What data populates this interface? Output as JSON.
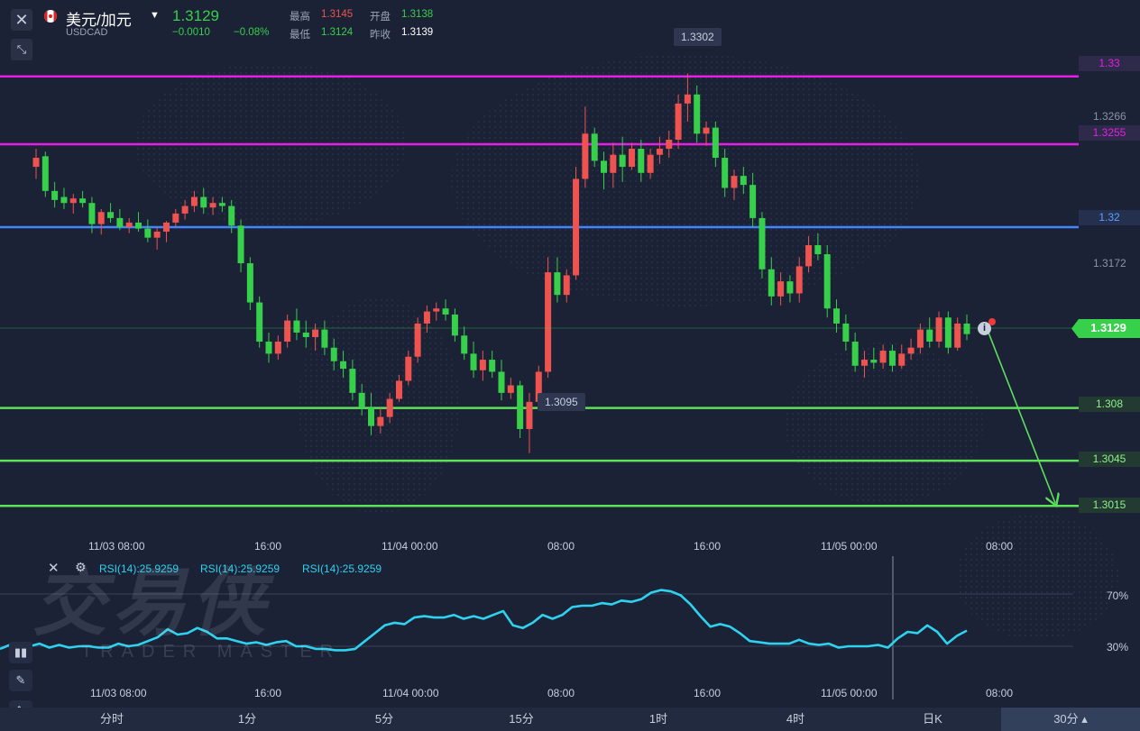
{
  "header": {
    "pair": "美元/加元",
    "symbol": "USDCAD",
    "last_price": "1.3129",
    "change": "−0.0010",
    "change_pct": "−0.08%",
    "high_label": "最高",
    "high": "1.3145",
    "open_label": "开盘",
    "open": "1.3138",
    "low_label": "最低",
    "low": "1.3124",
    "prev_close_label": "昨收",
    "prev_close": "1.3139",
    "up_color": "#37d04a",
    "down_color": "#ef5350"
  },
  "price_axis": {
    "labels": [
      "1.3266",
      "1.3172"
    ],
    "current_price_tag": "1.3129"
  },
  "levels": [
    {
      "label": "1.33",
      "color": "#e61ee6"
    },
    {
      "label": "1.3255",
      "color": "#e61ee6"
    },
    {
      "label": "1.32",
      "color": "#3f86ff"
    },
    {
      "label": "1.308",
      "color": "#5de05a"
    },
    {
      "label": "1.3045",
      "color": "#5de05a"
    },
    {
      "label": "1.3015",
      "color": "#5de05a"
    }
  ],
  "annotations": {
    "high_marker": "1.3302",
    "low_marker": "1.3095"
  },
  "time_axis_main": [
    "11/03 08:00",
    "16:00",
    "11/04 00:00",
    "08:00",
    "16:00",
    "11/05 00:00",
    "08:00"
  ],
  "time_axis_rsi": [
    "11/03 08:00",
    "16:00",
    "11/04 00:00",
    "08:00",
    "16:00",
    "11/05 00:00",
    "08:00"
  ],
  "rsi": {
    "legend": [
      "RSI(14):25.9259",
      "RSI(14):25.9259",
      "RSI(14):25.9259"
    ],
    "level_labels": [
      "70%",
      "30%"
    ],
    "line_color": "#2fd2ee"
  },
  "watermark": {
    "brand_cn": "交易侠",
    "brand_en": "TRADER MASTER"
  },
  "tabs": [
    "分时",
    "1分",
    "5分",
    "15分",
    "1时",
    "4时",
    "日K",
    "30分"
  ],
  "selected_tab": "30分",
  "icons": {
    "close": "close-icon",
    "resize": "resize-icon",
    "settings": "settings-icon",
    "indicator": "indicator-icon",
    "pen": "pen-icon",
    "rsi": "rsi-icon",
    "info": "info-icon"
  },
  "chart_data": {
    "type": "candlestick",
    "ohlc": [
      [
        1.324,
        1.3252,
        1.3232,
        1.3246
      ],
      [
        1.3247,
        1.325,
        1.322,
        1.3224
      ],
      [
        1.3224,
        1.323,
        1.3213,
        1.3218
      ],
      [
        1.322,
        1.3226,
        1.3212,
        1.3216
      ],
      [
        1.3216,
        1.3222,
        1.3209,
        1.3219
      ],
      [
        1.3219,
        1.3224,
        1.3213,
        1.3216
      ],
      [
        1.3216,
        1.322,
        1.3196,
        1.3202
      ],
      [
        1.3202,
        1.3212,
        1.3195,
        1.321
      ],
      [
        1.321,
        1.3216,
        1.3203,
        1.3206
      ],
      [
        1.3206,
        1.3212,
        1.3198,
        1.32
      ],
      [
        1.32,
        1.3206,
        1.3196,
        1.3203
      ],
      [
        1.3203,
        1.321,
        1.3197,
        1.3199
      ],
      [
        1.3199,
        1.3205,
        1.319,
        1.3193
      ],
      [
        1.3193,
        1.32,
        1.3185,
        1.3197
      ],
      [
        1.3197,
        1.3204,
        1.319,
        1.3203
      ],
      [
        1.3203,
        1.3212,
        1.32,
        1.3209
      ],
      [
        1.3209,
        1.3218,
        1.3205,
        1.3214
      ],
      [
        1.3214,
        1.3224,
        1.321,
        1.322
      ],
      [
        1.322,
        1.3226,
        1.3209,
        1.3213
      ],
      [
        1.3213,
        1.322,
        1.3208,
        1.3216
      ],
      [
        1.3216,
        1.322,
        1.321,
        1.3214
      ],
      [
        1.3214,
        1.3218,
        1.3196,
        1.3201
      ],
      [
        1.3201,
        1.3205,
        1.317,
        1.3176
      ],
      [
        1.3176,
        1.318,
        1.3145,
        1.315
      ],
      [
        1.315,
        1.3154,
        1.312,
        1.3124
      ],
      [
        1.3124,
        1.313,
        1.311,
        1.3116
      ],
      [
        1.3116,
        1.3128,
        1.3112,
        1.3124
      ],
      [
        1.3124,
        1.3142,
        1.312,
        1.3138
      ],
      [
        1.3138,
        1.3146,
        1.3125,
        1.313
      ],
      [
        1.313,
        1.3138,
        1.312,
        1.3127
      ],
      [
        1.3127,
        1.3136,
        1.3118,
        1.3132
      ],
      [
        1.3132,
        1.3138,
        1.3115,
        1.312
      ],
      [
        1.312,
        1.3126,
        1.3105,
        1.3111
      ],
      [
        1.3111,
        1.3118,
        1.31,
        1.3106
      ],
      [
        1.3106,
        1.3112,
        1.3085,
        1.309
      ],
      [
        1.309,
        1.3096,
        1.3075,
        1.308
      ],
      [
        1.308,
        1.309,
        1.3062,
        1.3068
      ],
      [
        1.3068,
        1.308,
        1.3063,
        1.3074
      ],
      [
        1.3074,
        1.309,
        1.307,
        1.3086
      ],
      [
        1.3086,
        1.3102,
        1.3084,
        1.3098
      ],
      [
        1.3098,
        1.3118,
        1.3095,
        1.3114
      ],
      [
        1.3114,
        1.314,
        1.311,
        1.3136
      ],
      [
        1.3136,
        1.3148,
        1.313,
        1.3144
      ],
      [
        1.3144,
        1.315,
        1.3138,
        1.3146
      ],
      [
        1.3146,
        1.3152,
        1.3138,
        1.3142
      ],
      [
        1.3142,
        1.3146,
        1.3124,
        1.3128
      ],
      [
        1.3128,
        1.3134,
        1.3112,
        1.3116
      ],
      [
        1.3116,
        1.3124,
        1.31,
        1.3105
      ],
      [
        1.3105,
        1.3118,
        1.3098,
        1.3112
      ],
      [
        1.3112,
        1.3118,
        1.31,
        1.3104
      ],
      [
        1.3104,
        1.3112,
        1.3085,
        1.309
      ],
      [
        1.309,
        1.31,
        1.3086,
        1.3095
      ],
      [
        1.3095,
        1.3098,
        1.306,
        1.3066
      ],
      [
        1.3066,
        1.309,
        1.305,
        1.3084
      ],
      [
        1.3084,
        1.3108,
        1.308,
        1.3104
      ],
      [
        1.3104,
        1.318,
        1.31,
        1.317
      ],
      [
        1.317,
        1.318,
        1.315,
        1.3155
      ],
      [
        1.3155,
        1.3172,
        1.315,
        1.3168
      ],
      [
        1.3168,
        1.324,
        1.3165,
        1.3232
      ],
      [
        1.3232,
        1.328,
        1.3226,
        1.3262
      ],
      [
        1.3262,
        1.3266,
        1.324,
        1.3244
      ],
      [
        1.3244,
        1.325,
        1.3225,
        1.3236
      ],
      [
        1.3236,
        1.3256,
        1.3226,
        1.3248
      ],
      [
        1.3248,
        1.326,
        1.323,
        1.324
      ],
      [
        1.324,
        1.3256,
        1.3238,
        1.3252
      ],
      [
        1.3252,
        1.3258,
        1.323,
        1.3236
      ],
      [
        1.3236,
        1.3252,
        1.3232,
        1.3248
      ],
      [
        1.3248,
        1.326,
        1.3242,
        1.3252
      ],
      [
        1.3252,
        1.3264,
        1.3246,
        1.3258
      ],
      [
        1.3258,
        1.3288,
        1.3252,
        1.3282
      ],
      [
        1.3282,
        1.3302,
        1.327,
        1.3288
      ],
      [
        1.3288,
        1.3294,
        1.3256,
        1.3262
      ],
      [
        1.3262,
        1.327,
        1.3254,
        1.3266
      ],
      [
        1.3266,
        1.327,
        1.324,
        1.3246
      ],
      [
        1.3246,
        1.3252,
        1.322,
        1.3226
      ],
      [
        1.3226,
        1.3238,
        1.3218,
        1.3234
      ],
      [
        1.3234,
        1.324,
        1.3222,
        1.3228
      ],
      [
        1.3228,
        1.3236,
        1.32,
        1.3206
      ],
      [
        1.3206,
        1.321,
        1.3166,
        1.3172
      ],
      [
        1.3172,
        1.318,
        1.3148,
        1.3154
      ],
      [
        1.3154,
        1.317,
        1.3148,
        1.3164
      ],
      [
        1.3164,
        1.3168,
        1.315,
        1.3156
      ],
      [
        1.3156,
        1.318,
        1.315,
        1.3174
      ],
      [
        1.3174,
        1.3194,
        1.317,
        1.3188
      ],
      [
        1.3188,
        1.3196,
        1.3178,
        1.3182
      ],
      [
        1.3182,
        1.3188,
        1.314,
        1.3146
      ],
      [
        1.3146,
        1.3152,
        1.313,
        1.3136
      ],
      [
        1.3136,
        1.3142,
        1.3118,
        1.3124
      ],
      [
        1.3124,
        1.313,
        1.3104,
        1.3108
      ],
      [
        1.3108,
        1.3118,
        1.31,
        1.3112
      ],
      [
        1.3112,
        1.312,
        1.3106,
        1.311
      ],
      [
        1.311,
        1.3122,
        1.3106,
        1.3118
      ],
      [
        1.3118,
        1.3122,
        1.3104,
        1.3108
      ],
      [
        1.3108,
        1.3122,
        1.3106,
        1.3116
      ],
      [
        1.3116,
        1.3126,
        1.3112,
        1.312
      ],
      [
        1.312,
        1.3136,
        1.3116,
        1.3132
      ],
      [
        1.3132,
        1.314,
        1.312,
        1.3124
      ],
      [
        1.3124,
        1.3144,
        1.312,
        1.314
      ],
      [
        1.314,
        1.3144,
        1.3116,
        1.312
      ],
      [
        1.312,
        1.314,
        1.3118,
        1.3136
      ],
      [
        1.3136,
        1.3142,
        1.3125,
        1.3129
      ]
    ],
    "rsi_values": [
      28,
      31,
      27,
      30,
      32,
      29,
      31,
      29,
      30,
      30,
      29,
      29,
      32,
      30,
      31,
      34,
      37,
      43,
      39,
      40,
      44,
      41,
      36,
      36,
      34,
      32,
      33,
      31,
      33,
      34,
      30,
      30,
      28,
      28,
      27,
      27,
      28,
      34,
      40,
      46,
      48,
      47,
      52,
      53,
      52,
      52,
      54,
      51,
      53,
      51,
      54,
      57,
      46,
      44,
      48,
      54,
      51,
      54,
      60,
      61,
      61,
      63,
      62,
      65,
      64,
      66,
      71,
      73,
      72,
      69,
      62,
      53,
      45,
      47,
      45,
      40,
      34,
      33,
      32,
      32,
      32,
      35,
      32,
      31,
      32,
      29,
      30,
      30,
      30,
      31,
      29,
      36,
      41,
      40,
      46,
      41,
      32,
      38,
      42
    ],
    "price_range": [
      1.2996,
      1.3322
    ],
    "rsi_range": [
      0,
      100
    ],
    "projection": {
      "from": 1.3129,
      "to": 1.3015
    }
  }
}
